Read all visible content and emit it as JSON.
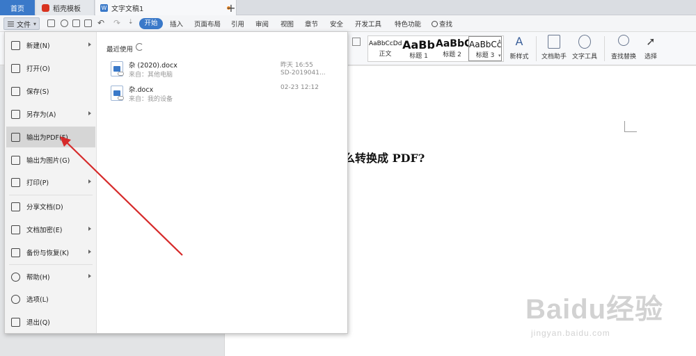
{
  "tabs": {
    "home": "首页",
    "templates": "稻壳模板",
    "document": "文字文稿1",
    "new_tab": "+"
  },
  "menubar": {
    "file_label": "文件",
    "active_tab": "开始",
    "items": [
      "插入",
      "页面布局",
      "引用",
      "审阅",
      "视图",
      "章节",
      "安全",
      "开发工具",
      "特色功能"
    ],
    "search_label": "查找"
  },
  "ribbon": {
    "styles": [
      {
        "sample": "AaBbCcDd",
        "name": "正文"
      },
      {
        "sample": "AaBb",
        "name": "标题 1"
      },
      {
        "sample": "AaBbC",
        "name": "标题 2"
      },
      {
        "sample": "AaBbCc",
        "name": "标题 3"
      }
    ],
    "tools": [
      "新样式",
      "文档助手",
      "文字工具",
      "查找替换",
      "选择"
    ]
  },
  "file_menu": {
    "items": [
      {
        "label": "新建(N)",
        "icon": "new-doc-icon",
        "submenu": true
      },
      {
        "label": "打开(O)",
        "icon": "folder-icon",
        "submenu": false
      },
      {
        "label": "保存(S)",
        "icon": "save-icon",
        "submenu": false
      },
      {
        "label": "另存为(A)",
        "icon": "save-as-icon",
        "submenu": true
      },
      {
        "label": "输出为PDF(F)",
        "icon": "pdf-export-icon",
        "submenu": false,
        "active": true
      },
      {
        "label": "输出为图片(G)",
        "icon": "image-export-icon",
        "submenu": false
      },
      {
        "label": "打印(P)",
        "icon": "printer-icon",
        "submenu": true
      },
      {
        "label": "分享文档(D)",
        "icon": "share-icon",
        "submenu": false
      },
      {
        "label": "文档加密(E)",
        "icon": "lock-icon",
        "submenu": true
      },
      {
        "label": "备份与恢复(K)",
        "icon": "backup-icon",
        "submenu": true
      },
      {
        "label": "帮助(H)",
        "icon": "help-icon",
        "submenu": true
      },
      {
        "label": "选项(L)",
        "icon": "gear-icon",
        "submenu": false
      },
      {
        "label": "退出(Q)",
        "icon": "exit-icon",
        "submenu": false
      }
    ],
    "recent_title": "最近使用",
    "recent": [
      {
        "name": "杂 (2020).docx",
        "source": "来自：其他电脑",
        "time": "昨天 16:55",
        "device": "SD-2019041..."
      },
      {
        "name": "杂.docx",
        "source": "来自：我的设备",
        "time": "02-23 12:12",
        "device": ""
      }
    ]
  },
  "document": {
    "heading_fragment": "么转换成 PDF?"
  },
  "watermark": {
    "main": "Baidu经验",
    "sub": "jingyan.baidu.com"
  },
  "colors": {
    "accent": "#3a79c9",
    "annotation_arrow": "#d62a2a"
  }
}
